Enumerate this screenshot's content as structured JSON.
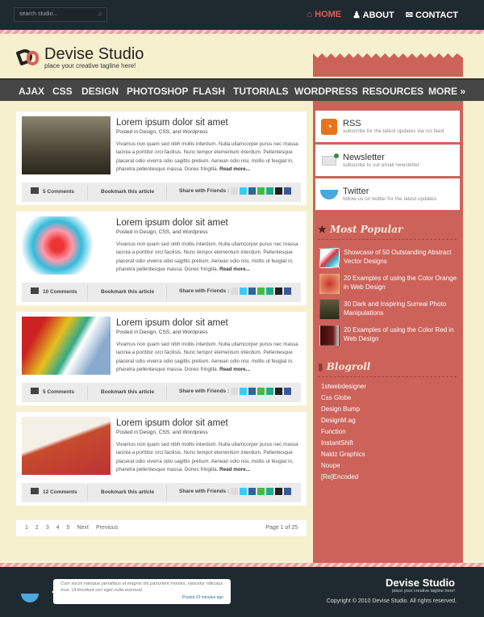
{
  "search": {
    "placeholder": "search studio..."
  },
  "topnav": [
    {
      "label": "HOME",
      "icon": "home-icon",
      "active": true
    },
    {
      "label": "ABOUT",
      "icon": "user-icon"
    },
    {
      "label": "CONTACT",
      "icon": "mail-icon"
    }
  ],
  "brand": {
    "name": "Devise Studio",
    "tagline": "place your creative tagline here!"
  },
  "nav": [
    "AJAX",
    "CSS",
    "DESIGN",
    "PHOTOSHOP",
    "FLASH",
    "TUTORIALS",
    "WORDPRESS",
    "RESOURCES",
    "MORE »"
  ],
  "posts": [
    {
      "title": "Lorem ipsum dolor sit amet",
      "meta": "Posted in Design, CSS, and Wordpress",
      "comments": "5 Comments",
      "image": "industrial-plant"
    },
    {
      "title": "Lorem ipsum dolor sit amet",
      "meta": "Posted in Design, CSS, and Wordpress",
      "comments": "10 Comments",
      "image": "abstract-bird"
    },
    {
      "title": "Lorem ipsum dolor sit amet",
      "meta": "Posted in Design, CSS, and Wordpress",
      "comments": "5 Comments",
      "image": "colored-pencils"
    },
    {
      "title": "Lorem ipsum dolor sit amet",
      "meta": "Posted in Design, CSS, and Wordpress",
      "comments": "12 Comments",
      "image": "business-cards"
    }
  ],
  "post_common": {
    "excerpt": "Vivamus non quam sed nibh mollis interdum. Nulla ullamcorper purus nec massa lacinia a porttitor orci facilisis. Nunc tempor elementum interdum. Pellentesque placerat odio viverra odio sagittis pretium. Aenean odio nisi, mollis ut feugiat in, pharetra pellentesque massa. Donec fringilla.",
    "read_more": "Read more...",
    "bookmark": "Bookmark this article",
    "share": "Share with Friends :"
  },
  "pagination": {
    "pages": [
      "1",
      "2",
      "3",
      "4",
      "5"
    ],
    "next": "Next",
    "previous": "Previous",
    "status": "Page 1 of 25"
  },
  "subscribe": [
    {
      "title": "RSS",
      "desc": "subscribe for the latest updates via rss feed",
      "icon": "rss-icon"
    },
    {
      "title": "Newsletter",
      "desc": "subscribe to our email newsletter",
      "icon": "envelope-icon"
    },
    {
      "title": "Twitter",
      "desc": "follow us on twitter for the latest updates",
      "icon": "twitter-bird-icon"
    }
  ],
  "popular": {
    "heading": "Most Popular",
    "items": [
      "Showcase of 50 Outstanding Abstract Vector Designs",
      "20 Examples of using the Color Orange in Web Design",
      "30 Dark and Inspiring Surreal Photo Manipulations",
      "20 Examples of using the Color Red in Web Design"
    ]
  },
  "blogroll": {
    "heading": "Blogroll",
    "items": [
      "1stwebdesigner",
      "Css Globe",
      "Design Bump",
      "DesignM.ag",
      "Function",
      "InstantShift",
      "Naldz Graphics",
      "Noupe",
      "[Re]Encoded"
    ]
  },
  "footer": {
    "tweet": "Cum sociis natoque penatibus et magnis dis parturient montes, nascetur ridiculus mus. Ut tincidunt orci eget nulla euismod.",
    "tweet_time": "Posted 20 minutes ago",
    "copyright": "Copyright © 2010 Devise Studio. All rights reserved."
  },
  "colors": {
    "accent": "#cc625a",
    "dark": "#1f2a30",
    "background": "#f7f0cf",
    "nav": "#454545"
  }
}
